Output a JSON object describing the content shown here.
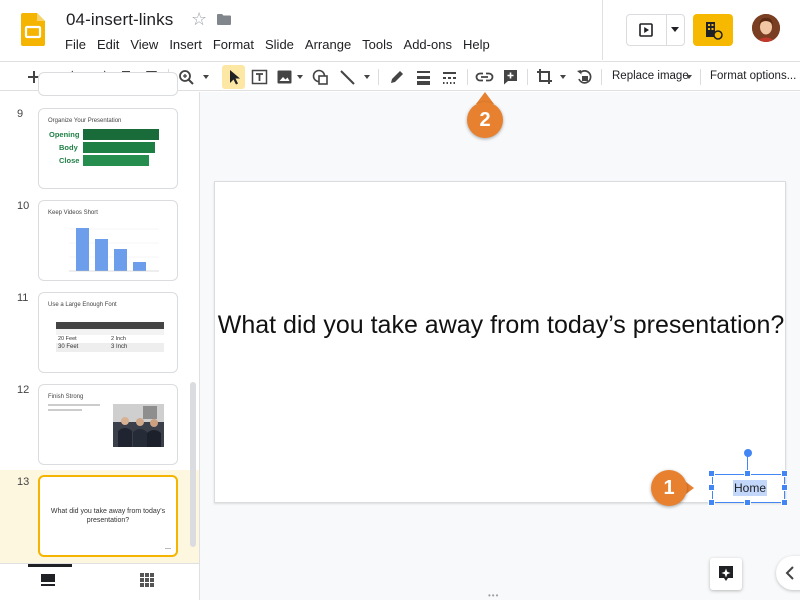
{
  "document": {
    "title": "04-insert-links"
  },
  "menu": [
    "File",
    "Edit",
    "View",
    "Insert",
    "Format",
    "Slide",
    "Arrange",
    "Tools",
    "Add-ons",
    "Help"
  ],
  "toolbar": {
    "replace_image_label": "Replace image",
    "format_options_label": "Format options..."
  },
  "filmstrip": {
    "slides": [
      {
        "number": "9",
        "title": "Organize Your Presentation",
        "rows": [
          "Opening",
          "Body",
          "Close"
        ]
      },
      {
        "number": "10",
        "title": "Keep Videos Short"
      },
      {
        "number": "11",
        "title": "Use a Large Enough Font",
        "table_rows": [
          [
            "20 Feet",
            "2 Inch"
          ],
          [
            "30 Feet",
            "3 Inch"
          ]
        ]
      },
      {
        "number": "12",
        "title": "Finish Strong"
      },
      {
        "number": "13",
        "text": "What did you take away from today's presentation?"
      }
    ]
  },
  "slide": {
    "main_text": "What did you take away from today’s presentation?",
    "link_box_text": "Home"
  },
  "callouts": {
    "first": "1",
    "second": "2"
  },
  "colors": {
    "accent": "#f4b400",
    "callout": "#e8812f",
    "selection": "#4285f4",
    "thumb_green": "#1e7f45"
  }
}
